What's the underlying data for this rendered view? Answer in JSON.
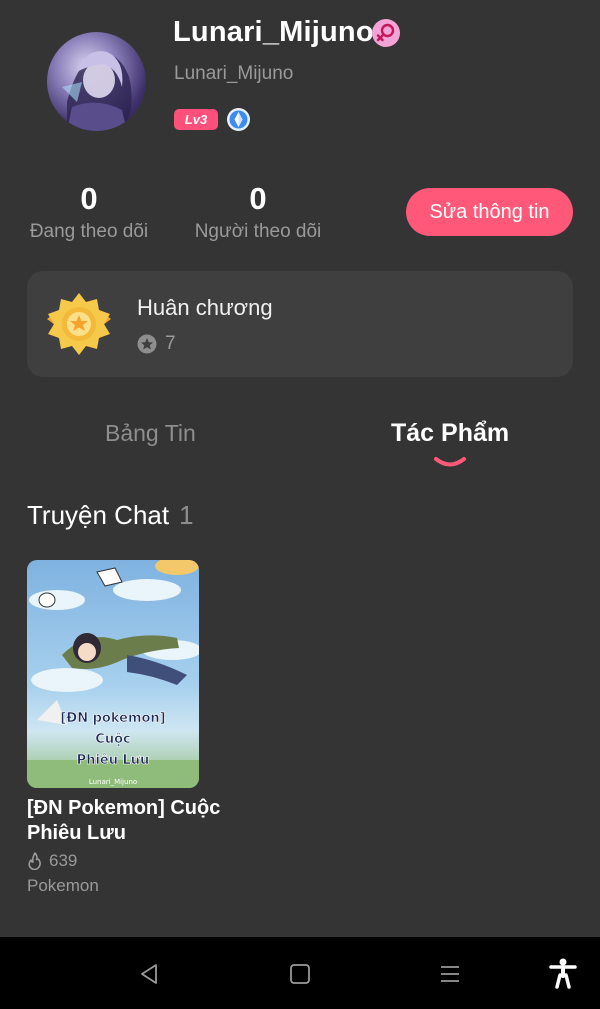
{
  "profile": {
    "display_name": "Lunari_Mijuno",
    "handle": "Lunari_Mijuno",
    "level": "Lv3",
    "gender_icon": "female-symbol-icon",
    "colors": {
      "accent": "#ff5878",
      "gender_badge": "#f3a3d6",
      "vip_badge": "#3f8cf0"
    }
  },
  "stats": {
    "following": {
      "count": "0",
      "label": "Đang theo dõi"
    },
    "followers": {
      "count": "0",
      "label": "Người theo dõi"
    }
  },
  "edit_button_label": "Sửa thông tin",
  "medal": {
    "title": "Huân chương",
    "count": "7"
  },
  "tabs": [
    {
      "label": "Bảng Tin",
      "active": false
    },
    {
      "label": "Tác Phẩm",
      "active": true
    }
  ],
  "section": {
    "title": "Truyện Chat",
    "count": "1"
  },
  "story": {
    "cover_lines": [
      "[ĐN pokemon]",
      "Cuộc",
      "Phiêu Lưu"
    ],
    "cover_credit": "Lunari_Mijuno",
    "title": "[ĐN Pokemon] Cuộc Phiêu Lưu",
    "views": "639",
    "category": "Pokemon"
  },
  "navigation": [
    "back-icon",
    "home-icon",
    "menu-icon",
    "accessibility-icon"
  ]
}
